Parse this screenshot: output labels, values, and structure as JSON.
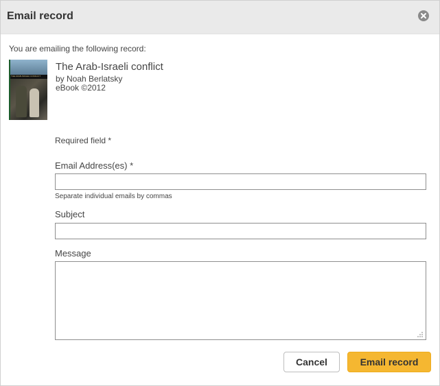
{
  "dialog": {
    "title": "Email record",
    "close_icon": "close-icon"
  },
  "record": {
    "intro": "You are emailing the following record:",
    "title": "The Arab-Israeli conflict",
    "author": "by Noah Berlatsky",
    "format": "eBook ©2012",
    "cover_text": "THE ARAB-ISRAELI CONFLICT"
  },
  "form": {
    "required_note": "Required field *",
    "email_label": "Email Address(es) *",
    "email_value": "",
    "email_hint": "Separate individual emails by commas",
    "subject_label": "Subject",
    "subject_value": "",
    "message_label": "Message",
    "message_value": ""
  },
  "actions": {
    "cancel_label": "Cancel",
    "send_label": "Email record"
  },
  "colors": {
    "titlebar": "#eaeaea",
    "primary_button": "#f5b731",
    "close_icon": "#8a8a8a"
  }
}
